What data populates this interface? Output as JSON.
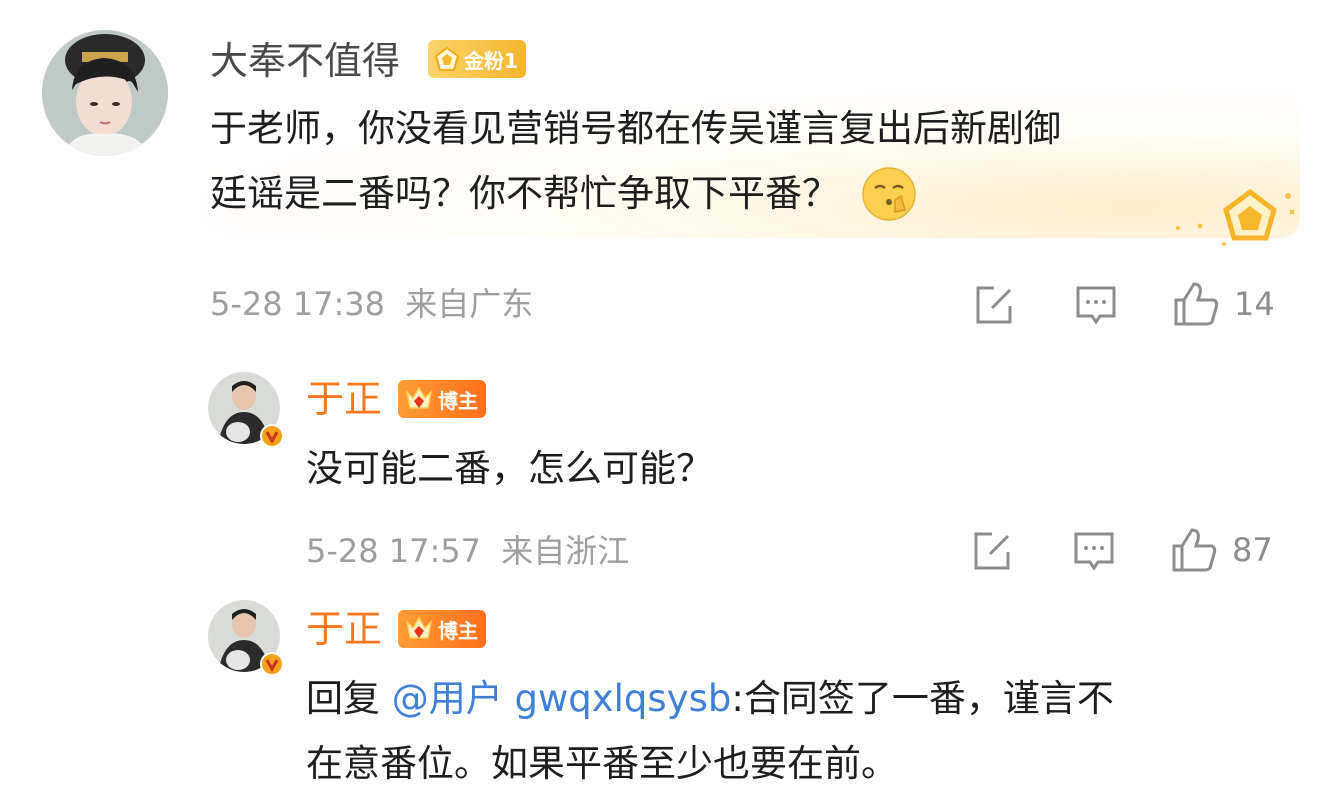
{
  "comments": [
    {
      "username": "大奉不值得",
      "badge": "金粉1",
      "content_line1": "于老师，你没看见营销号都在传吴谨言复出后新剧御",
      "content_line2": "廷谣是二番吗？你不帮忙争取下平番？",
      "date": "5-28 17:38",
      "location": "来自广东",
      "like_count": "14"
    },
    {
      "username": "于正",
      "badge": "博主",
      "content": "没可能二番，怎么可能？",
      "date": "5-28 17:57",
      "location": "来自浙江",
      "like_count": "87"
    },
    {
      "username": "于正",
      "badge": "博主",
      "reply_prefix": "回复",
      "mention": "@用户 gwqxlqsysb",
      "content_after": ":合同签了一番，谨言不",
      "content_line2": "在意番位。如果平番至少也要在前。"
    }
  ],
  "icons": [
    "repost-icon",
    "comment-icon",
    "like-icon",
    "verified-icon",
    "crown-icon",
    "gold-fan-icon",
    "shush-emoji"
  ],
  "colors": {
    "accent": "#f5781f",
    "mention": "#3e7fd8",
    "meta": "#9e9e9e",
    "gold_badge": "#f5b52e"
  }
}
